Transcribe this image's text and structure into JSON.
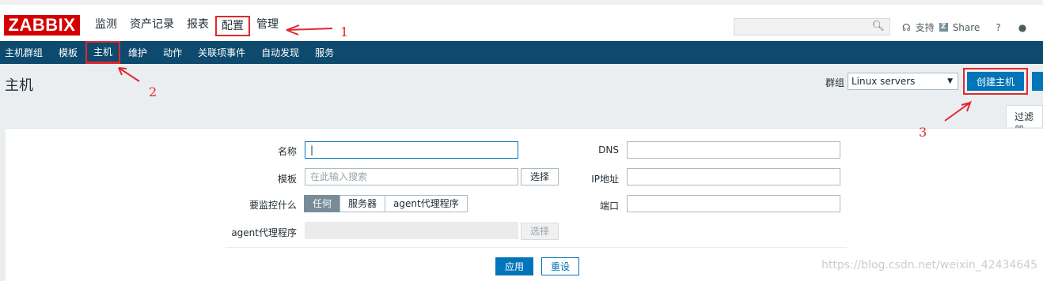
{
  "brand": {
    "logo": "ZABBIX"
  },
  "top_nav": {
    "items": [
      "监测",
      "资产记录",
      "报表",
      "配置",
      "管理"
    ],
    "active": "配置"
  },
  "top_right": {
    "support": "支持",
    "share": "Share",
    "help": "?"
  },
  "sub_nav": {
    "items": [
      "主机群组",
      "模板",
      "主机",
      "维护",
      "动作",
      "关联项事件",
      "自动发现",
      "服务"
    ],
    "active": "主机"
  },
  "page": {
    "title": "主机",
    "group_label": "群组",
    "group_value": "Linux servers",
    "create_button": "创建主机"
  },
  "filter": {
    "tab_label": "过滤器",
    "name_label": "名称",
    "template_label": "模板",
    "template_placeholder": "在此输入搜索",
    "select_button": "选择",
    "monitor_label": "要监控什么",
    "monitor_options": [
      "任何",
      "服务器",
      "agent代理程序"
    ],
    "monitor_selected": "任何",
    "proxy_label": "agent代理程序",
    "proxy_select_button": "选择",
    "dns_label": "DNS",
    "ip_label": "IP地址",
    "port_label": "端口",
    "apply_button": "应用",
    "reset_button": "重设"
  },
  "annotations": [
    "1",
    "2",
    "3"
  ],
  "watermark": "https://blog.csdn.net/weixin_42434645",
  "colors": {
    "brand_red": "#d40000",
    "subnav_bg": "#0d4a6e",
    "primary_blue": "#0275b8",
    "annotation_red": "#e0282e"
  }
}
